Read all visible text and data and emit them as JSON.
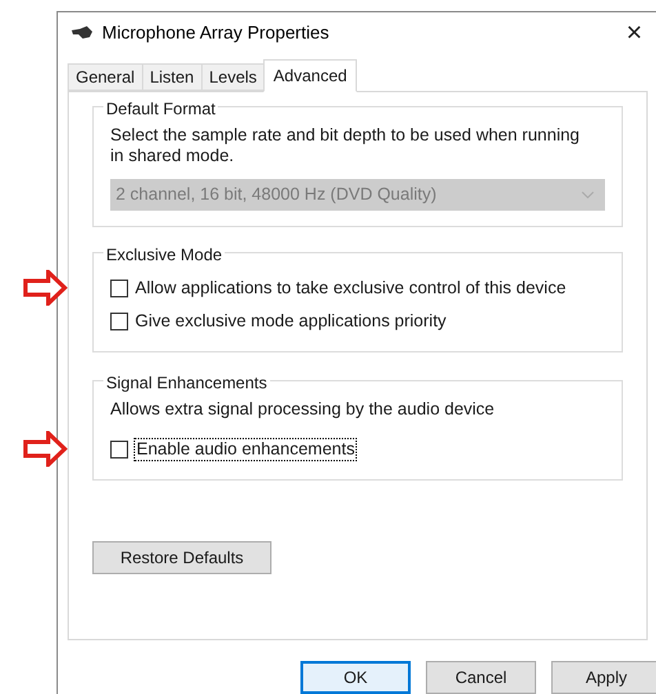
{
  "window": {
    "title": "Microphone Array Properties",
    "close": "×"
  },
  "tabs": [
    {
      "label": "General",
      "selected": false
    },
    {
      "label": "Listen",
      "selected": false
    },
    {
      "label": "Levels",
      "selected": false
    },
    {
      "label": "Advanced",
      "selected": true
    }
  ],
  "default_format": {
    "title": "Default Format",
    "description": "Select the sample rate and bit depth to be used when running in shared mode.",
    "dropdown": {
      "value": "2 channel, 16 bit, 48000 Hz (DVD Quality)",
      "disabled": true
    }
  },
  "exclusive_mode": {
    "title": "Exclusive Mode",
    "options": [
      {
        "label": "Allow applications to take exclusive control of this device",
        "checked": false,
        "focused": false,
        "annotated": true
      },
      {
        "label": "Give exclusive mode applications priority",
        "checked": false,
        "focused": false,
        "annotated": false
      }
    ]
  },
  "signal_enhancements": {
    "title": "Signal Enhancements",
    "description": "Allows extra signal processing by the audio device",
    "options": [
      {
        "label": "Enable audio enhancements",
        "checked": false,
        "focused": true,
        "annotated": true
      }
    ]
  },
  "restore_button": "Restore Defaults",
  "buttons": [
    {
      "label": "OK",
      "default": true
    },
    {
      "label": "Cancel",
      "default": false
    },
    {
      "label": "Apply",
      "default": false
    }
  ]
}
